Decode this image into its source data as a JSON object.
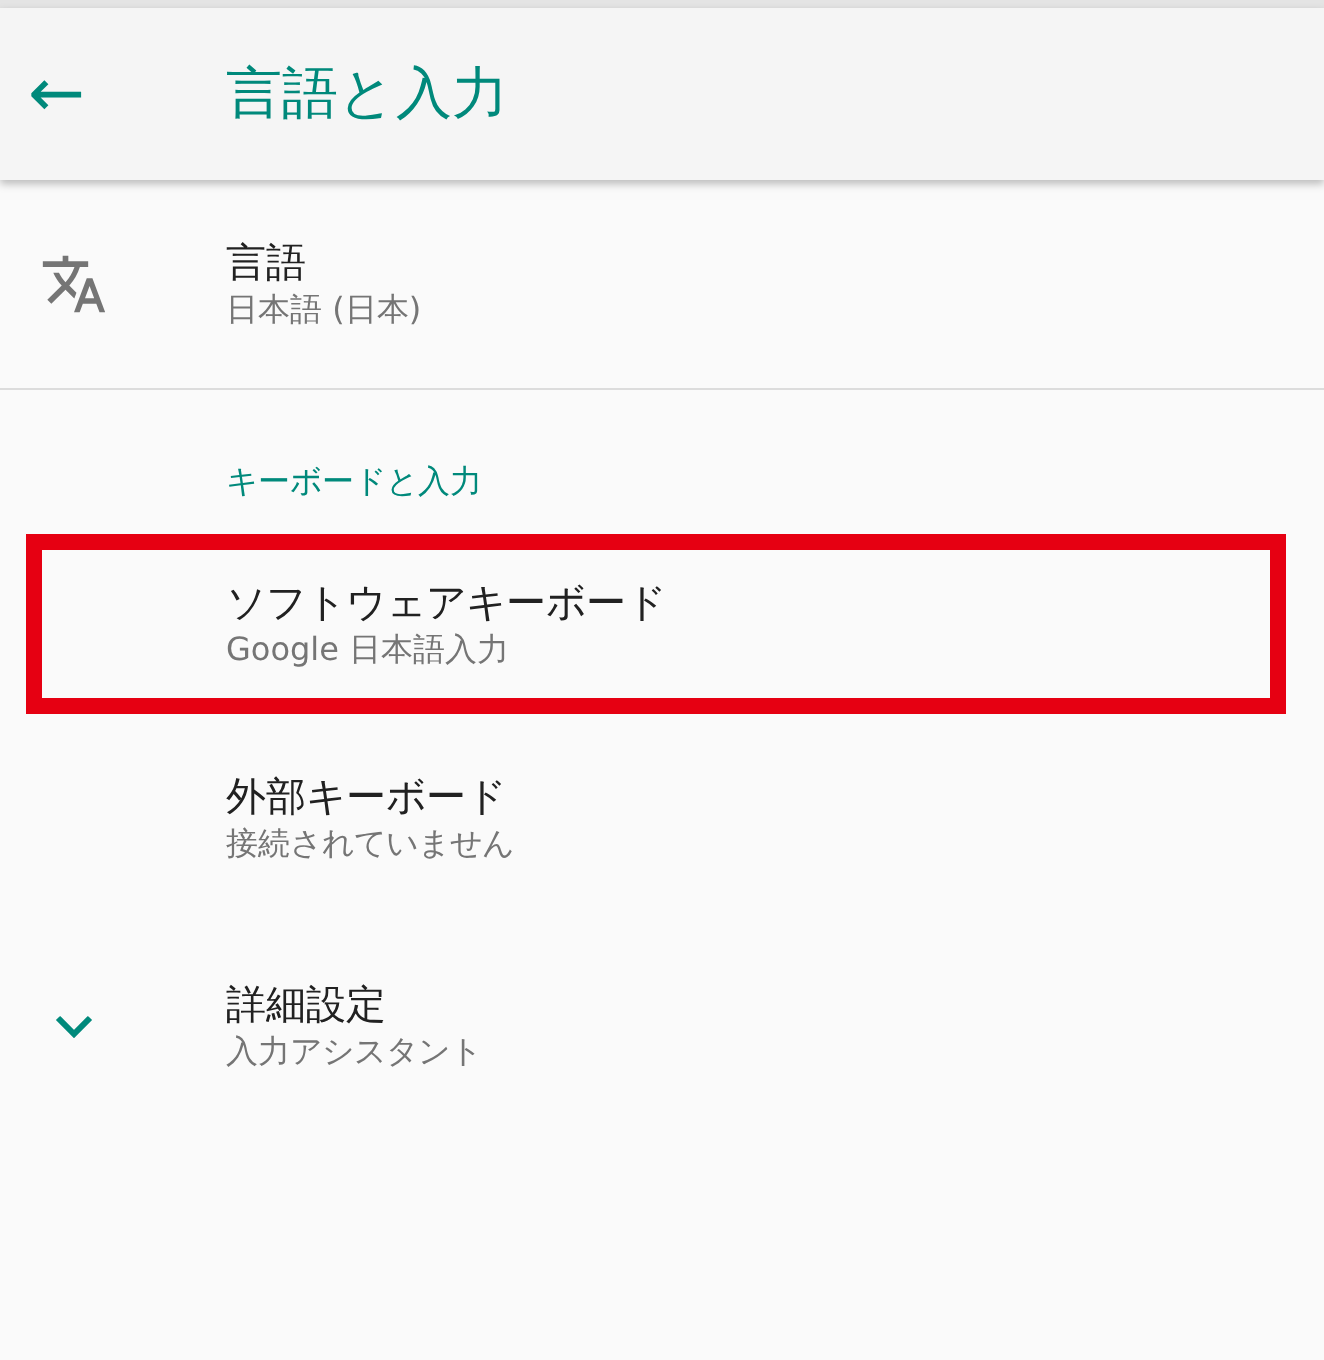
{
  "app_bar": {
    "back": "←",
    "title": "言語と入力"
  },
  "sections": [
    {
      "items": [
        {
          "kind": "language",
          "title": "言語",
          "summary": "日本語 (日本)",
          "highlighted": false
        }
      ]
    },
    {
      "header": "キーボードと入力",
      "items": [
        {
          "kind": "plain",
          "title": "ソフトウェアキーボード",
          "summary": "Google 日本語入力",
          "highlighted": true
        },
        {
          "kind": "plain",
          "title": "外部キーボード",
          "summary": "接続されていません",
          "highlighted": false
        },
        {
          "kind": "expand",
          "title": "詳細設定",
          "summary": "入力アシスタント",
          "highlighted": false
        }
      ]
    }
  ]
}
